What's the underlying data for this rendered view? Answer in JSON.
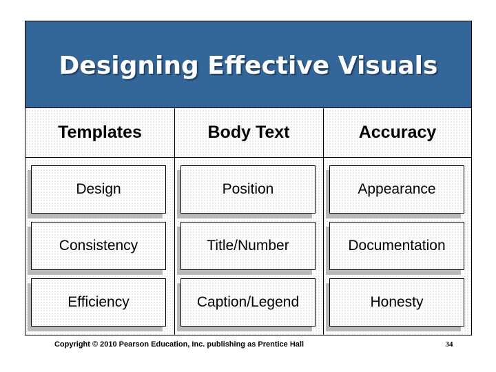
{
  "slide": {
    "title": "Designing Effective Visuals",
    "colors": {
      "title_bar": "#336699",
      "title_text": "#ffffff",
      "box_shadow": "#b9b9b9"
    },
    "columns": [
      {
        "header": "Templates",
        "items": [
          "Design",
          "Consistency",
          "Efficiency"
        ]
      },
      {
        "header": "Body Text",
        "items": [
          "Position",
          "Title/Number",
          "Caption/Legend"
        ]
      },
      {
        "header": "Accuracy",
        "items": [
          "Appearance",
          "Documentation",
          "Honesty"
        ]
      }
    ]
  },
  "footer": {
    "copyright": "Copyright © 2010 Pearson Education, Inc. publishing as Prentice Hall",
    "page_number": "34"
  }
}
